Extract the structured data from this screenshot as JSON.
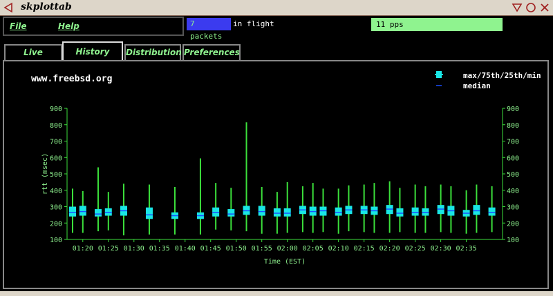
{
  "window": {
    "title": "skplottab"
  },
  "menu": {
    "file": "File",
    "help": "Help"
  },
  "status": {
    "packets": "7 packets",
    "inflight": "in flight",
    "pps": "11 pps"
  },
  "tabs": [
    {
      "label": "Live"
    },
    {
      "label": "History"
    },
    {
      "label": "Distribution"
    },
    {
      "label": "Preferences"
    }
  ],
  "colors": {
    "whisker": "#3be03b",
    "box": "#19e6e6",
    "median": "#1a4fff",
    "axis": "#3be03b",
    "label": "#8ff38f"
  },
  "chart_data": {
    "type": "boxplot",
    "title": "www.freebsd.org",
    "xlabel": "Time (EST)",
    "ylabel": "rtt (msec)",
    "ylim": [
      100,
      900
    ],
    "yticks": [
      100,
      200,
      300,
      400,
      500,
      600,
      700,
      800,
      900
    ],
    "xtick_labels": [
      "01:20",
      "01:25",
      "01:30",
      "01:35",
      "01:40",
      "01:45",
      "01:50",
      "01:55",
      "02:00",
      "02:05",
      "02:10",
      "02:15",
      "02:20",
      "02:25",
      "02:30",
      "02:35"
    ],
    "legend": [
      {
        "label": "max/75th/25th/min",
        "icon": "box-icon"
      },
      {
        "label": "median",
        "icon": "median-line-icon"
      }
    ],
    "series": [
      {
        "time": "01:18",
        "min": 140,
        "q1": 240,
        "median": 265,
        "q3": 300,
        "max": 410
      },
      {
        "time": "01:20",
        "min": 140,
        "q1": 245,
        "median": 270,
        "q3": 305,
        "max": 395
      },
      {
        "time": "01:23",
        "min": 150,
        "q1": 240,
        "median": 255,
        "q3": 285,
        "max": 540
      },
      {
        "time": "01:25",
        "min": 155,
        "q1": 245,
        "median": 265,
        "q3": 290,
        "max": 390
      },
      {
        "time": "01:28",
        "min": 125,
        "q1": 245,
        "median": 275,
        "q3": 305,
        "max": 440
      },
      {
        "time": "01:33",
        "min": 130,
        "q1": 225,
        "median": 250,
        "q3": 295,
        "max": 435
      },
      {
        "time": "01:38",
        "min": 130,
        "q1": 225,
        "median": 245,
        "q3": 265,
        "max": 420
      },
      {
        "time": "01:43",
        "min": 130,
        "q1": 225,
        "median": 245,
        "q3": 265,
        "max": 595
      },
      {
        "time": "01:46",
        "min": 160,
        "q1": 240,
        "median": 265,
        "q3": 295,
        "max": 445
      },
      {
        "time": "01:49",
        "min": 155,
        "q1": 240,
        "median": 255,
        "q3": 285,
        "max": 415
      },
      {
        "time": "01:52",
        "min": 150,
        "q1": 250,
        "median": 275,
        "q3": 305,
        "max": 815
      },
      {
        "time": "01:55",
        "min": 135,
        "q1": 245,
        "median": 270,
        "q3": 305,
        "max": 420
      },
      {
        "time": "01:58",
        "min": 135,
        "q1": 240,
        "median": 260,
        "q3": 290,
        "max": 390
      },
      {
        "time": "02:00",
        "min": 140,
        "q1": 240,
        "median": 260,
        "q3": 290,
        "max": 450
      },
      {
        "time": "02:03",
        "min": 145,
        "q1": 255,
        "median": 280,
        "q3": 305,
        "max": 425
      },
      {
        "time": "02:05",
        "min": 140,
        "q1": 245,
        "median": 270,
        "q3": 300,
        "max": 445
      },
      {
        "time": "02:07",
        "min": 145,
        "q1": 245,
        "median": 275,
        "q3": 300,
        "max": 410
      },
      {
        "time": "02:10",
        "min": 135,
        "q1": 245,
        "median": 265,
        "q3": 295,
        "max": 410
      },
      {
        "time": "02:12",
        "min": 150,
        "q1": 255,
        "median": 280,
        "q3": 305,
        "max": 430
      },
      {
        "time": "02:15",
        "min": 145,
        "q1": 255,
        "median": 280,
        "q3": 305,
        "max": 435
      },
      {
        "time": "02:17",
        "min": 140,
        "q1": 250,
        "median": 275,
        "q3": 300,
        "max": 445
      },
      {
        "time": "02:20",
        "min": 140,
        "q1": 255,
        "median": 285,
        "q3": 310,
        "max": 455
      },
      {
        "time": "02:22",
        "min": 145,
        "q1": 240,
        "median": 260,
        "q3": 290,
        "max": 415
      },
      {
        "time": "02:25",
        "min": 140,
        "q1": 245,
        "median": 265,
        "q3": 295,
        "max": 435
      },
      {
        "time": "02:27",
        "min": 140,
        "q1": 245,
        "median": 265,
        "q3": 290,
        "max": 425
      },
      {
        "time": "02:30",
        "min": 145,
        "q1": 255,
        "median": 285,
        "q3": 310,
        "max": 435
      },
      {
        "time": "02:32",
        "min": 140,
        "q1": 245,
        "median": 275,
        "q3": 305,
        "max": 425
      },
      {
        "time": "02:35",
        "min": 135,
        "q1": 240,
        "median": 260,
        "q3": 280,
        "max": 400
      },
      {
        "time": "02:37",
        "min": 140,
        "q1": 250,
        "median": 275,
        "q3": 310,
        "max": 435
      },
      {
        "time": "02:40",
        "min": 145,
        "q1": 245,
        "median": 265,
        "q3": 295,
        "max": 425
      }
    ]
  }
}
